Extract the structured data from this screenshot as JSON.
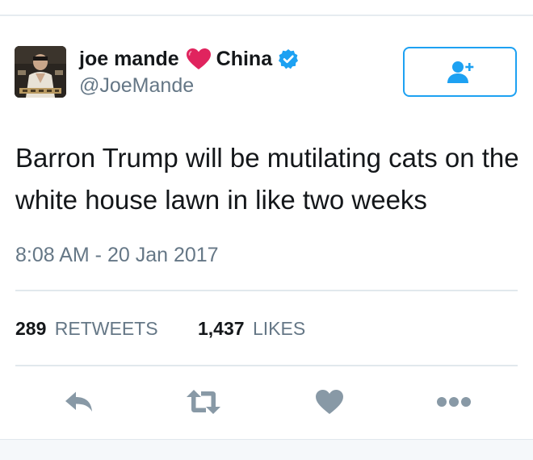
{
  "user": {
    "name_first": "joe mande",
    "name_second": "China",
    "handle": "@JoeMande"
  },
  "tweet": {
    "text": "Barron Trump will be mutilating cats on the white house lawn in like two weeks",
    "timestamp": "8:08 AM - 20 Jan 2017"
  },
  "stats": {
    "retweets_count": "289",
    "retweets_label": "RETWEETS",
    "likes_count": "1,437",
    "likes_label": "LIKES"
  },
  "icons": {
    "heart": "heart-emoji-icon",
    "verified": "verified-badge-icon",
    "follow": "add-user-icon",
    "reply": "reply-icon",
    "retweet": "retweet-icon",
    "like": "like-heart-icon",
    "more": "more-dots-icon"
  },
  "colors": {
    "accent": "#1da1f2",
    "heart": "#e0245e",
    "action_gray": "#8899a6",
    "secondary_text": "#657786"
  }
}
